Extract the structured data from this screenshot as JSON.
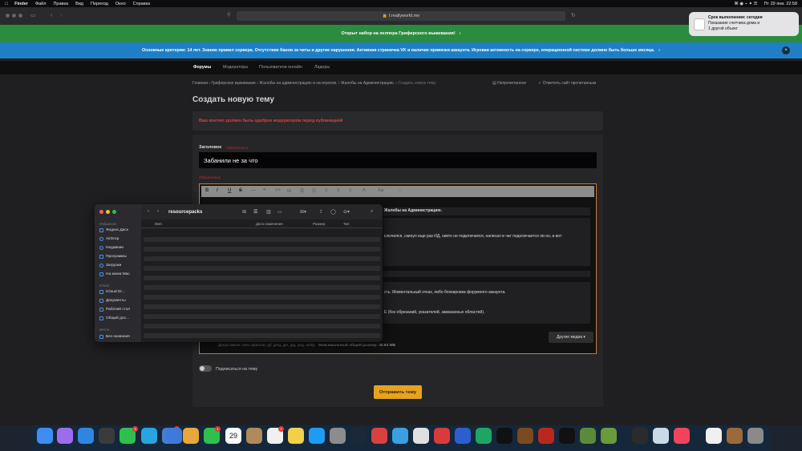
{
  "menubar": {
    "apple": "",
    "items": [
      "Finder",
      "Файл",
      "Правка",
      "Вид",
      "Переход",
      "Окно",
      "Справка"
    ],
    "datetime": "Пт 29 янв. 22:58"
  },
  "browser": {
    "url": "f.reallyworld.me"
  },
  "banners": {
    "green": "Открыт набор на хелпера Гриферского выживания!",
    "blue": "Основные критерии: 14 лет. Знание правил сервера. Отсутствие банов за читы и другие нарушения. Активная страничка VK и наличие привязки аккаунта. Игровая активность на сервере, операционной системе должно быть больше месяца."
  },
  "nav": {
    "items": [
      "Форумы",
      "Модераторы",
      "Пользователи онлайн",
      "Лидеры"
    ]
  },
  "breadcrumbs": {
    "items": [
      "Главная",
      "Гриферское выживание",
      "Жалобы на администрацию и на игроков.",
      "Жалобы на Администрацию.",
      "Создать новую тему"
    ],
    "unread": "Непрочитанное",
    "mark_read": "Отметить сайт прочитанным"
  },
  "page": {
    "title": "Создать новую тему",
    "notice": "Ваш контент должен быть одобрен модератором перед публикацией"
  },
  "form": {
    "title_label": "Заголовок",
    "title_required": "Обязательно",
    "title_value": "Забанили не за что",
    "message_label": "Обязательно",
    "editor_line1": "Жалобы на Администрацию.",
    "editor_line2": "ключился, скинул еще раз ИД, никто не подключился, написал в чат подключается ли он, и вот",
    "editor_line3": "сть. Моментальный отказ, либо блокировка форумного аккаунта.",
    "editor_line4": "Е (без обрезаний, указателей, замазанных областей).",
    "other_media": "Другие медиа ▾",
    "allowed_label": "Допустимые типы файлов:",
    "allowed_types": "gif, jpeg, jpe, jpg, png, webp",
    "max_size_label": "Максимальный общий размер:",
    "max_size": "48.83 МБ",
    "subscribe": "Подписаться на тему",
    "submit": "Отправить тему"
  },
  "finder": {
    "folder": "resourcepacks",
    "sections": {
      "favorites": "Избранное",
      "icloud": "iCloud",
      "places": "Места"
    },
    "favorites": [
      "Яндекс.Диск",
      "AirDrop",
      "Недавние",
      "Программы",
      "Загрузки",
      "На моем Mac"
    ],
    "icloud_items": [
      "iCloud Dr...",
      "Документы",
      "Рабочий стол",
      "Общий дос..."
    ],
    "places_items": [
      "Без названия"
    ],
    "columns": {
      "name": "Имя",
      "date": "Дата изменения",
      "size": "Размер",
      "kind": "Тип"
    }
  },
  "notification": {
    "title": "Срок выполнения: сегодня",
    "line1": "Показание счетчика дома и",
    "line2": "1 другой объект"
  },
  "dock": {
    "badges": [
      "5",
      "1",
      "322",
      "1",
      "2"
    ],
    "calendar_day": "29"
  }
}
